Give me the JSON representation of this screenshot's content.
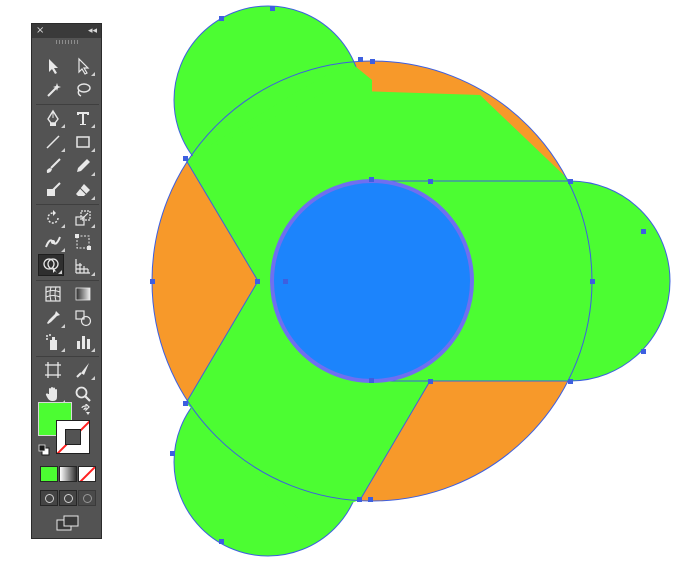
{
  "panel": {
    "close_label": "×",
    "collapse_label": "◂◂"
  },
  "tools": [
    {
      "name": "selection-tool",
      "icon": "arrow-black-icon"
    },
    {
      "name": "direct-selection-tool",
      "icon": "arrow-white-icon"
    },
    {
      "name": "magic-wand-tool",
      "icon": "magic-wand-icon"
    },
    {
      "name": "lasso-tool",
      "icon": "lasso-icon"
    },
    {
      "name": "pen-tool",
      "icon": "pen-icon"
    },
    {
      "name": "type-tool",
      "icon": "type-icon"
    },
    {
      "name": "line-segment-tool",
      "icon": "line-icon"
    },
    {
      "name": "rectangle-tool",
      "icon": "rectangle-icon"
    },
    {
      "name": "paintbrush-tool",
      "icon": "paintbrush-icon"
    },
    {
      "name": "pencil-tool",
      "icon": "pencil-icon"
    },
    {
      "name": "blob-brush-tool",
      "icon": "blob-brush-icon"
    },
    {
      "name": "eraser-tool",
      "icon": "eraser-icon"
    },
    {
      "name": "rotate-tool",
      "icon": "rotate-icon"
    },
    {
      "name": "scale-tool",
      "icon": "scale-icon"
    },
    {
      "name": "width-tool",
      "icon": "width-icon"
    },
    {
      "name": "free-transform-tool",
      "icon": "free-transform-icon"
    },
    {
      "name": "shape-builder-tool",
      "icon": "shape-builder-icon",
      "active": true
    },
    {
      "name": "perspective-grid-tool",
      "icon": "perspective-grid-icon"
    },
    {
      "name": "mesh-tool",
      "icon": "mesh-icon"
    },
    {
      "name": "gradient-tool",
      "icon": "gradient-icon"
    },
    {
      "name": "eyedropper-tool",
      "icon": "eyedropper-icon"
    },
    {
      "name": "blend-tool",
      "icon": "blend-icon"
    },
    {
      "name": "symbol-sprayer-tool",
      "icon": "symbol-sprayer-icon"
    },
    {
      "name": "column-graph-tool",
      "icon": "column-graph-icon"
    },
    {
      "name": "artboard-tool",
      "icon": "artboard-icon"
    },
    {
      "name": "slice-tool",
      "icon": "slice-icon"
    },
    {
      "name": "hand-tool",
      "icon": "hand-icon"
    },
    {
      "name": "zoom-tool",
      "icon": "zoom-icon"
    }
  ],
  "colors": {
    "fill": "#4cfd32",
    "stroke": "none",
    "green_shape": "#4cfd32",
    "orange_shape": "#f7992a",
    "blue_circle": "#1c84fc",
    "selection": "#3d5fe0",
    "panel_bg": "#535353"
  },
  "artwork": {
    "shapes": [
      "green-lobe-top",
      "green-lobe-right",
      "green-lobe-bottom",
      "orange-segment-left",
      "orange-segment-bottom",
      "green-band-top",
      "green-band-right",
      "green-band-bottom",
      "blue-center-circle"
    ]
  }
}
